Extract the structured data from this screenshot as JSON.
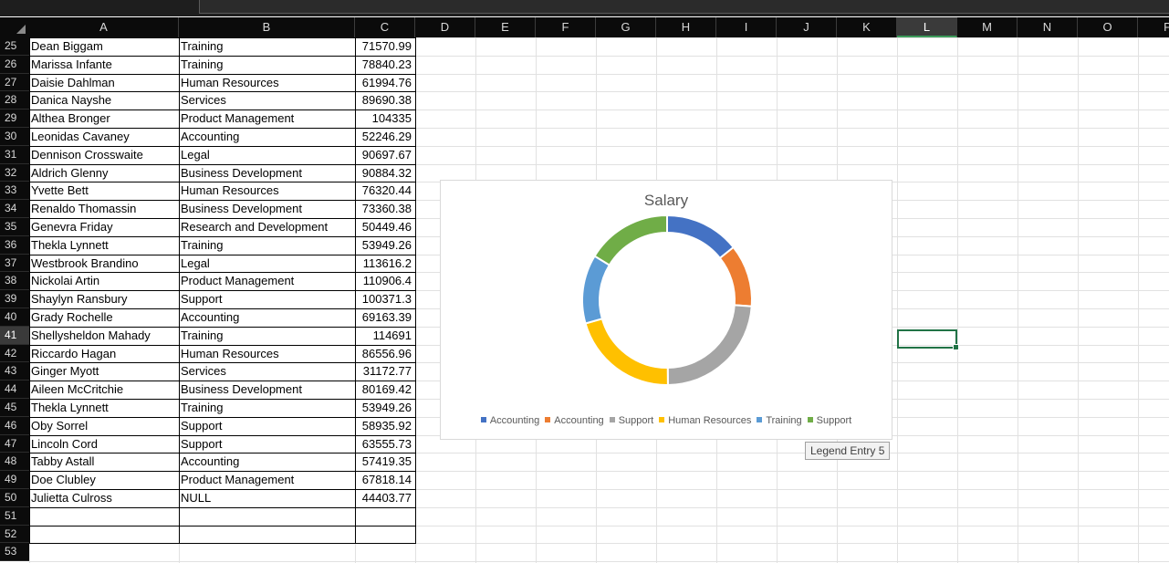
{
  "columns": [
    "A",
    "B",
    "C",
    "D",
    "E",
    "F",
    "G",
    "H",
    "I",
    "J",
    "K",
    "L",
    "M",
    "N",
    "O",
    "P"
  ],
  "selected_column": "L",
  "selected_row": "41",
  "rows": [
    {
      "row": "25",
      "name": "Dean Biggam",
      "dept": "Training",
      "salary": "71570.99"
    },
    {
      "row": "26",
      "name": "Marissa Infante",
      "dept": "Training",
      "salary": "78840.23"
    },
    {
      "row": "27",
      "name": "Daisie Dahlman",
      "dept": "Human Resources",
      "salary": "61994.76"
    },
    {
      "row": "28",
      "name": "Danica Nayshe",
      "dept": "Services",
      "salary": "89690.38"
    },
    {
      "row": "29",
      "name": "Althea  Bronger",
      "dept": "Product Management",
      "salary": "104335"
    },
    {
      "row": "30",
      "name": "Leonidas Cavaney",
      "dept": "Accounting",
      "salary": "52246.29"
    },
    {
      "row": "31",
      "name": "Dennison Crosswaite",
      "dept": "Legal",
      "salary": "90697.67"
    },
    {
      "row": "32",
      "name": "Aldrich  Glenny",
      "dept": "Business Development",
      "salary": "90884.32"
    },
    {
      "row": "33",
      "name": "Yvette  Bett",
      "dept": "Human Resources",
      "salary": "76320.44"
    },
    {
      "row": "34",
      "name": "Renaldo Thomassin",
      "dept": "Business Development",
      "salary": "73360.38"
    },
    {
      "row": "35",
      "name": "Genevra Friday",
      "dept": "Research and Development",
      "salary": "50449.46"
    },
    {
      "row": "36",
      "name": "Thekla Lynnett",
      "dept": "Training",
      "salary": "53949.26"
    },
    {
      "row": "37",
      "name": "Westbrook Brandino",
      "dept": "Legal",
      "salary": "113616.2"
    },
    {
      "row": "38",
      "name": "Nickolai  Artin",
      "dept": "Product Management",
      "salary": "110906.4"
    },
    {
      "row": "39",
      "name": "Shaylyn Ransbury",
      "dept": "Support",
      "salary": "100371.3"
    },
    {
      "row": "40",
      "name": "Grady Rochelle",
      "dept": "Accounting",
      "salary": "69163.39"
    },
    {
      "row": "41",
      "name": "Shellysheldon Mahady",
      "dept": "Training",
      "salary": "114691"
    },
    {
      "row": "42",
      "name": "Riccardo Hagan",
      "dept": "Human Resources",
      "salary": "86556.96"
    },
    {
      "row": "43",
      "name": "Ginger  Myott",
      "dept": "Services",
      "salary": "31172.77"
    },
    {
      "row": "44",
      "name": "Aileen McCritchie",
      "dept": "Business Development",
      "salary": "80169.42"
    },
    {
      "row": "45",
      "name": "Thekla Lynnett",
      "dept": "Training",
      "salary": "53949.26"
    },
    {
      "row": "46",
      "name": "Oby Sorrel",
      "dept": "Support",
      "salary": "58935.92"
    },
    {
      "row": "47",
      "name": "Lincoln Cord",
      "dept": "Support",
      "salary": "63555.73"
    },
    {
      "row": "48",
      "name": "Tabby  Astall",
      "dept": "Accounting",
      "salary": "57419.35"
    },
    {
      "row": "49",
      "name": "Doe Clubley",
      "dept": "Product Management",
      "salary": "67818.14"
    },
    {
      "row": "50",
      "name": "Julietta Culross",
      "dept": "NULL",
      "salary": "44403.77"
    },
    {
      "row": "51",
      "name": "",
      "dept": "",
      "salary": ""
    },
    {
      "row": "52",
      "name": "",
      "dept": "",
      "salary": ""
    },
    {
      "row": "53",
      "name": "",
      "dept": "",
      "salary": ""
    }
  ],
  "chart_data": {
    "type": "pie",
    "donut": true,
    "title": "Salary",
    "categories": [
      "Accounting",
      "Accounting",
      "Support",
      "Human Resources",
      "Training",
      "Support"
    ],
    "values": [
      69163.39,
      57419.35,
      114691,
      100371.3,
      63555.73,
      78840.23
    ],
    "colors": [
      "#4472c4",
      "#ed7d31",
      "#a5a5a5",
      "#ffc000",
      "#5b9bd5",
      "#70ad47"
    ],
    "legend_position": "bottom"
  },
  "tooltip": "Legend Entry 5"
}
